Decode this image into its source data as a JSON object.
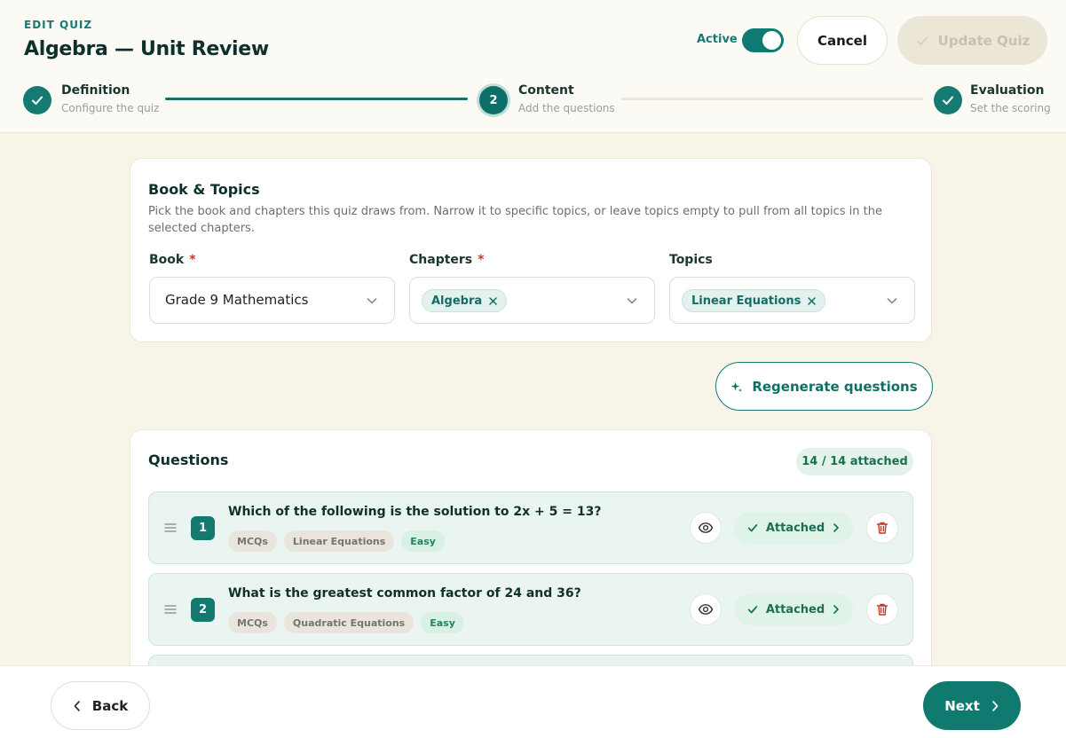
{
  "header": {
    "eyebrow": "EDIT QUIZ",
    "title": "Algebra — Unit Review",
    "active_label": "Active",
    "active": true,
    "cancel_label": "Cancel",
    "update_label": "Update Quiz"
  },
  "stepper": {
    "steps": [
      {
        "title": "Definition",
        "subtitle": "Configure the quiz",
        "status": "done"
      },
      {
        "title": "Content",
        "subtitle": "Add the questions",
        "status": "current",
        "number": "2"
      },
      {
        "title": "Evaluation",
        "subtitle": "Set the scoring",
        "status": "done"
      }
    ]
  },
  "book_topics": {
    "title": "Book & Topics",
    "description": "Pick the book and chapters this quiz draws from. Narrow it to specific topics, or leave topics empty to pull from all topics in the selected chapters.",
    "book": {
      "label": "Book",
      "required_mark": "*",
      "value": "Grade 9 Mathematics"
    },
    "chapters": {
      "label": "Chapters",
      "required_mark": "*",
      "chips": [
        "Algebra"
      ]
    },
    "topics": {
      "label": "Topics",
      "chips": [
        "Linear Equations"
      ]
    }
  },
  "regenerate_label": "Regenerate questions",
  "questions": {
    "title": "Questions",
    "count_label": "14 / 14 attached",
    "items": [
      {
        "number": "1",
        "text": "Which of the following is the solution to 2x + 5 = 13?",
        "tags": [
          "MCQs",
          "Linear Equations"
        ],
        "difficulty": "Easy",
        "attached_label": "Attached"
      },
      {
        "number": "2",
        "text": "What is the greatest common factor of 24 and 36?",
        "tags": [
          "MCQs",
          "Quadratic Equations"
        ],
        "difficulty": "Easy",
        "attached_label": "Attached"
      }
    ]
  },
  "footer": {
    "back_label": "Back",
    "next_label": "Next"
  },
  "colors": {
    "primary": "#137a72",
    "background": "#f8f5e8",
    "success_bg": "#dff3e7",
    "danger": "#c0392b"
  },
  "icons": {
    "check": "check-icon",
    "chevron_down": "chevron-down-icon",
    "close": "close-icon",
    "sparkle": "sparkle-icon",
    "drag": "drag-handle-icon",
    "eye": "eye-icon",
    "trash": "trash-icon",
    "chevron_left": "chevron-left-icon",
    "chevron_right": "chevron-right-icon"
  }
}
